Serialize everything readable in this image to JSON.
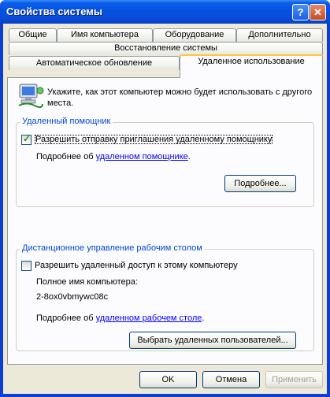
{
  "window": {
    "title": "Свойства системы"
  },
  "titlebar": {
    "help": "?",
    "close": "✕"
  },
  "tabs": {
    "row1": [
      "Общие",
      "Имя компьютера",
      "Оборудование",
      "Дополнительно"
    ],
    "row2": [
      "Восстановление системы"
    ],
    "row3": [
      "Автоматическое обновление",
      "Удаленное использование"
    ],
    "active": "Удаленное использование"
  },
  "intro": {
    "text": "Укажите, как этот компьютер можно будет использовать с другого места."
  },
  "assistance": {
    "legend": "Удаленный помощник",
    "checkbox_label": "Разрешить отправку приглашения удаленному помощнику",
    "checked": true,
    "more_prefix": "Подробнее об ",
    "more_link": "удаленном помощнике",
    "more_suffix": ".",
    "advanced_button": "Подробнее..."
  },
  "desktop": {
    "legend": "Дистанционное управление рабочим столом",
    "checkbox_label": "Разрешить удаленный доступ к этому компьютеру",
    "checked": false,
    "fullname_label": "Полное имя компьютера:",
    "fullname_value": "2-8ox0vbmywc08c",
    "more_prefix": "Подробнее об ",
    "more_link": "удаленном рабочем столе",
    "more_suffix": ".",
    "select_users_button": "Выбрать удаленных пользователей..."
  },
  "footer": {
    "ok": "OK",
    "cancel": "Отмена",
    "apply": "Применить"
  }
}
